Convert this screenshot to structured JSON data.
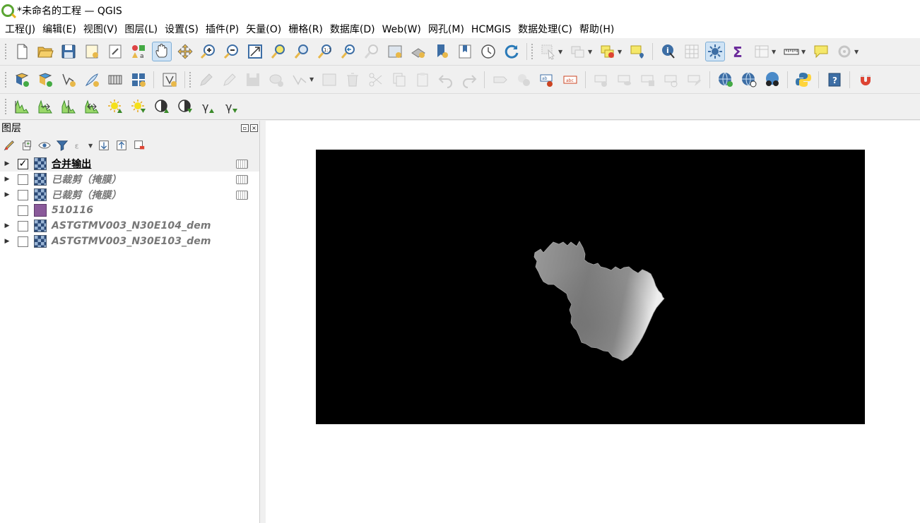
{
  "window": {
    "title": "*未命名的工程 — QGIS"
  },
  "menu": [
    "工程(J)",
    "编辑(E)",
    "视图(V)",
    "图层(L)",
    "设置(S)",
    "插件(P)",
    "矢量(O)",
    "栅格(R)",
    "数据库(D)",
    "Web(W)",
    "网孔(M)",
    "HCMGIS",
    "数据处理(C)",
    "帮助(H)"
  ],
  "layers_panel": {
    "title": "图层",
    "layers": [
      {
        "name": "合并输出",
        "checked": true,
        "type": "raster",
        "expandable": true,
        "memory": true
      },
      {
        "name": "已裁剪（掩膜）",
        "checked": false,
        "type": "raster",
        "expandable": true,
        "memory": true
      },
      {
        "name": "已裁剪（掩膜）",
        "checked": false,
        "type": "raster",
        "expandable": true,
        "memory": true
      },
      {
        "name": "510116",
        "checked": false,
        "type": "polygon",
        "expandable": false,
        "memory": false
      },
      {
        "name": "ASTGTMV003_N30E104_dem",
        "checked": false,
        "type": "raster",
        "expandable": true,
        "memory": false
      },
      {
        "name": "ASTGTMV003_N30E103_dem",
        "checked": false,
        "type": "raster",
        "expandable": true,
        "memory": false
      }
    ]
  },
  "colors": {
    "polygon_layer": "#8a5a9a",
    "canvas_background": "#ffffff",
    "raster_nodata": "#000000"
  },
  "icons": {
    "toolbar1": [
      "new-project-icon",
      "open-project-icon",
      "save-project-icon",
      "new-print-layout-icon",
      "layout-manager-icon",
      "style-manager-icon",
      "pan-icon",
      "pan-to-selection-icon",
      "zoom-in-icon",
      "zoom-out-icon",
      "zoom-full-icon",
      "zoom-to-selection-icon",
      "zoom-to-layer-icon",
      "zoom-native-icon",
      "zoom-last-icon",
      "zoom-next-icon",
      "new-map-view-icon",
      "new-3d-view-icon",
      "new-bookmark-icon",
      "show-bookmarks-icon",
      "temporal-controller-icon",
      "refresh-icon",
      "select-features-icon",
      "deselect-icon",
      "select-by-expression-icon",
      "annotation-icon",
      "identify-icon",
      "attribute-table-icon",
      "statistics-icon",
      "sum-icon",
      "field-calculator-icon",
      "measure-icon",
      "map-tips-icon",
      "locator-icon"
    ],
    "toolbar2": [
      "add-vector-layer-icon",
      "add-raster-layer-icon",
      "new-shapefile-icon",
      "digitize-icon",
      "virtual-layer-icon",
      "grid-icon",
      "vertex-tool-icon",
      "edit-toggle-icon",
      "pencil-icon",
      "save-edits-icon",
      "add-feature-icon",
      "vertex-editor-icon",
      "delete-icon",
      "cut-icon",
      "copy-icon",
      "paste-icon",
      "undo-icon",
      "redo-icon",
      "label-icon",
      "label-pin-icon",
      "label-highlight-icon",
      "show-labels-icon",
      "move-label-icon",
      "rotate-label-icon",
      "change-label-icon",
      "web-globe-icon",
      "web-search-icon",
      "binoculars-icon",
      "python-icon",
      "help-icon",
      "magnet-icon"
    ],
    "toolbar3": [
      "histogram-icon",
      "histogram-stretch-icon",
      "histogram-local-icon",
      "histogram-cumulative-icon",
      "brightness-up-icon",
      "brightness-down-icon",
      "contrast-up-icon",
      "contrast-down-icon",
      "gamma-up-icon",
      "gamma-down-icon"
    ]
  }
}
